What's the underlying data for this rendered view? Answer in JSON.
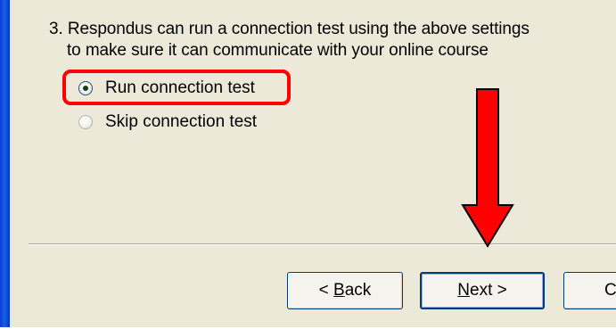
{
  "instructions": {
    "line1": "3. Respondus can run a connection test using the above settings",
    "line2": "to make sure it can communicate with your online course"
  },
  "options": {
    "run_label": "Run connection test",
    "skip_label": "Skip connection test",
    "selected": "run"
  },
  "buttons": {
    "back_prefix": "< ",
    "back_accel": "B",
    "back_rest": "ack",
    "next_accel": "N",
    "next_rest": "ext >",
    "cancel_partial": "C"
  },
  "annotations": {
    "highlight_color": "#ff0000",
    "arrow_color": "#ff0000",
    "arrow_icon": "down-arrow-icon"
  }
}
